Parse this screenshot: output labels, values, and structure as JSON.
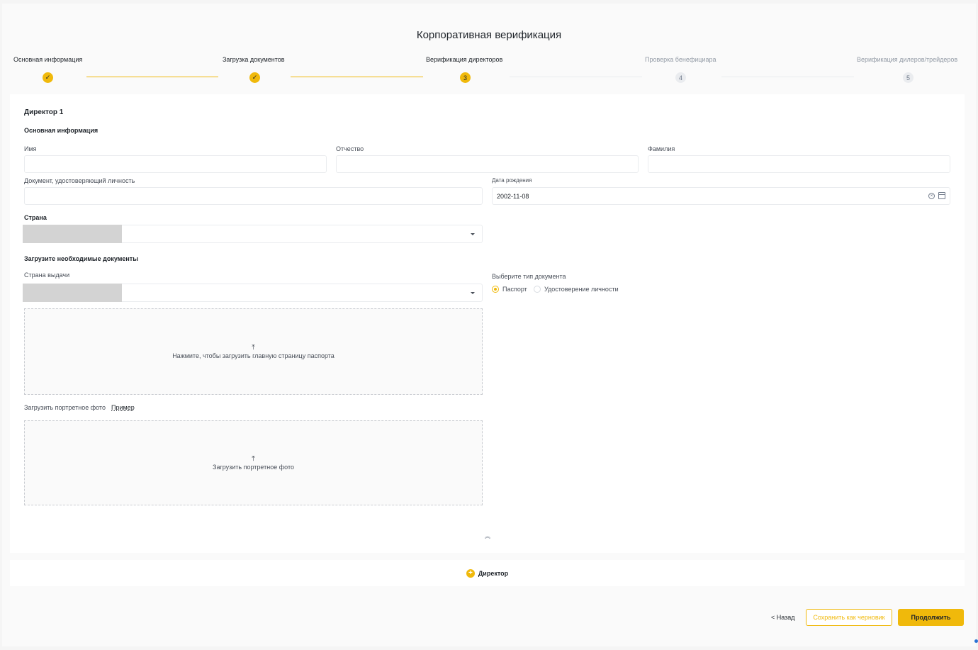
{
  "page_title": "Корпоративная верификация",
  "stepper": {
    "steps": [
      {
        "label": "Основная информация",
        "state": "done",
        "marker": "✓"
      },
      {
        "label": "Загрузка документов",
        "state": "done",
        "marker": "✓"
      },
      {
        "label": "Верификация директоров",
        "state": "current",
        "marker": "3"
      },
      {
        "label": "Проверка бенефициара",
        "state": "future",
        "marker": "4"
      },
      {
        "label": "Верификация дилеров/трейдеров",
        "state": "future",
        "marker": "5"
      }
    ]
  },
  "director": {
    "heading": "Директор 1",
    "basic_info_heading": "Основная информация",
    "first_name_label": "Имя",
    "first_name_value": "",
    "middle_name_label": "Отчество",
    "middle_name_value": "",
    "last_name_label": "Фамилия",
    "last_name_value": "",
    "id_doc_label": "Документ, удостоверяющий личность",
    "id_doc_value": "",
    "dob_label": "Дата рождения",
    "dob_value": "2002-11-08",
    "country_label": "Страна",
    "upload_heading": "Загрузите необходимые документы",
    "issuing_country_label": "Страна выдачи",
    "doc_type_label": "Выберите тип документа",
    "doc_type_options": [
      "Паспорт",
      "Удостоверение личности"
    ],
    "doc_type_selected": "Паспорт",
    "passport_upload_text": "Нажмите, чтобы загрузить главную страницу паспорта",
    "portrait_label": "Загрузить портретное фото",
    "portrait_example_link": "Пример",
    "portrait_upload_text": "Загрузить портретное фото"
  },
  "add_director_label": "Директор",
  "footer": {
    "back_label": "< Назад",
    "save_draft_label": "Сохранить как черновик",
    "continue_label": "Продолжить"
  },
  "colors": {
    "accent": "#f0b90b",
    "text": "#1e2329",
    "muted": "#929aa5"
  },
  "icons": {
    "done_step": "check-icon",
    "upload": "upload-icon",
    "collapse": "chevron-up-double-icon",
    "add": "plus-circle-icon",
    "clear": "clear-circle-icon",
    "calendar": "calendar-icon"
  }
}
